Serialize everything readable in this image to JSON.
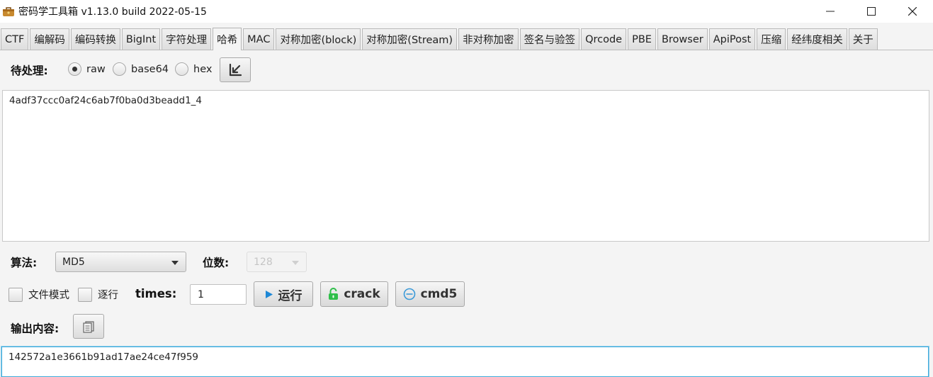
{
  "window": {
    "title": "密码学工具箱 v1.13.0 build 2022-05-15",
    "app_icon": "toolbox-icon",
    "controls": [
      "minimize-icon",
      "maximize-icon",
      "close-icon"
    ]
  },
  "tabs": [
    {
      "label": "CTF"
    },
    {
      "label": "编解码"
    },
    {
      "label": "编码转换"
    },
    {
      "label": "BigInt"
    },
    {
      "label": "字符处理"
    },
    {
      "label": "哈希",
      "active": true
    },
    {
      "label": "MAC"
    },
    {
      "label": "对称加密(block)"
    },
    {
      "label": "对称加密(Stream)"
    },
    {
      "label": "非对称加密"
    },
    {
      "label": "签名与验签"
    },
    {
      "label": "Qrcode"
    },
    {
      "label": "PBE"
    },
    {
      "label": "Browser"
    },
    {
      "label": "ApiPost"
    },
    {
      "label": "压缩"
    },
    {
      "label": "经纬度相关"
    },
    {
      "label": "关于"
    }
  ],
  "input": {
    "label": "待处理:",
    "encodings": [
      {
        "label": "raw",
        "selected": true
      },
      {
        "label": "base64",
        "selected": false
      },
      {
        "label": "hex",
        "selected": false
      }
    ],
    "import_icon": "import-arrow-icon",
    "value": "4adf37ccc0af24c6ab7f0ba0d3beadd1_4"
  },
  "options": {
    "algo_label": "算法:",
    "algo_value": "MD5",
    "bits_label": "位数:",
    "bits_value": "128",
    "file_mode_label": "文件模式",
    "line_by_line_label": "逐行",
    "times_label": "times:",
    "times_value": "1"
  },
  "actions": {
    "run_label": "运行",
    "crack_label": "crack",
    "cmd5_label": "cmd5"
  },
  "output": {
    "label": "输出内容:",
    "copy_icon": "copy-icon",
    "value": "142572a1e3661b91ad17ae24ce47f959"
  },
  "colors": {
    "accent": "#3fa9d8",
    "run_icon": "#1e88d6",
    "crack_icon": "#2fbf4a",
    "cmd5_icon": "#3b9ad9"
  }
}
